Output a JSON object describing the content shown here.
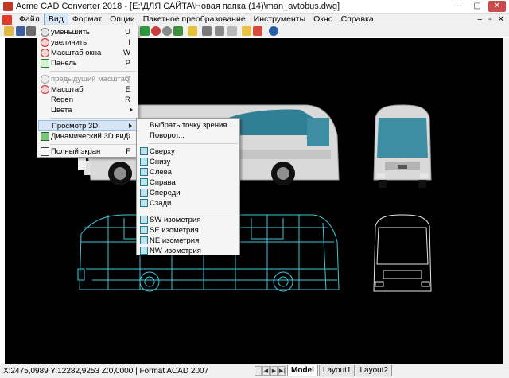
{
  "window": {
    "title": "Acme CAD Converter 2018 - [E:\\ДЛЯ САЙТА\\Новая папка (14)\\man_avtobus.dwg]",
    "minimize": "–",
    "maximize": "▢",
    "close": "✕"
  },
  "menubar": {
    "items": [
      "Файл",
      "Вид",
      "Формат",
      "Опции",
      "Пакетное преобразование",
      "Инструменты",
      "Окно",
      "Справка"
    ],
    "right": [
      "–",
      "▫",
      "✕"
    ]
  },
  "view_menu": {
    "items": [
      {
        "label": "уменьшить",
        "key": "U"
      },
      {
        "label": "увеличить",
        "key": "I"
      },
      {
        "label": "Масштаб окна",
        "key": "W"
      },
      {
        "label": "Панель",
        "key": "P"
      },
      {
        "label": "предыдущий масштаб",
        "key": "Q"
      },
      {
        "label": "Масштаб",
        "key": "E"
      },
      {
        "label": "Regen",
        "key": "R"
      },
      {
        "label": "Цвета",
        "key": ""
      },
      {
        "label": "Просмотр 3D",
        "key": ""
      },
      {
        "label": "Динамический 3D вид",
        "key": "D"
      },
      {
        "label": "Полный экран",
        "key": "F"
      }
    ]
  },
  "view3d_submenu": {
    "items": [
      "Выбрать точку зрения...",
      "Поворот...",
      "Сверху",
      "Снизу",
      "Слева",
      "Справа",
      "Спереди",
      "Сзади",
      "SW изометрия",
      "SE изометрия",
      "NE изометрия",
      "NW изометрия"
    ]
  },
  "statusbar": {
    "coords": "X:2475,0989 Y:12282,9253 Z:0,0000 | Format ACAD 2007",
    "nav": [
      "|◀",
      "◀",
      "▶",
      "▶|"
    ],
    "tabs": [
      "Model",
      "Layout1",
      "Layout2"
    ]
  },
  "colors": {
    "canvas": "#000000",
    "bus_body": "#dcdcdc",
    "bus_glass": "#3d8ea3",
    "wireframe": "#3fc7d8",
    "menu_highlight": "#d5e4f6"
  }
}
